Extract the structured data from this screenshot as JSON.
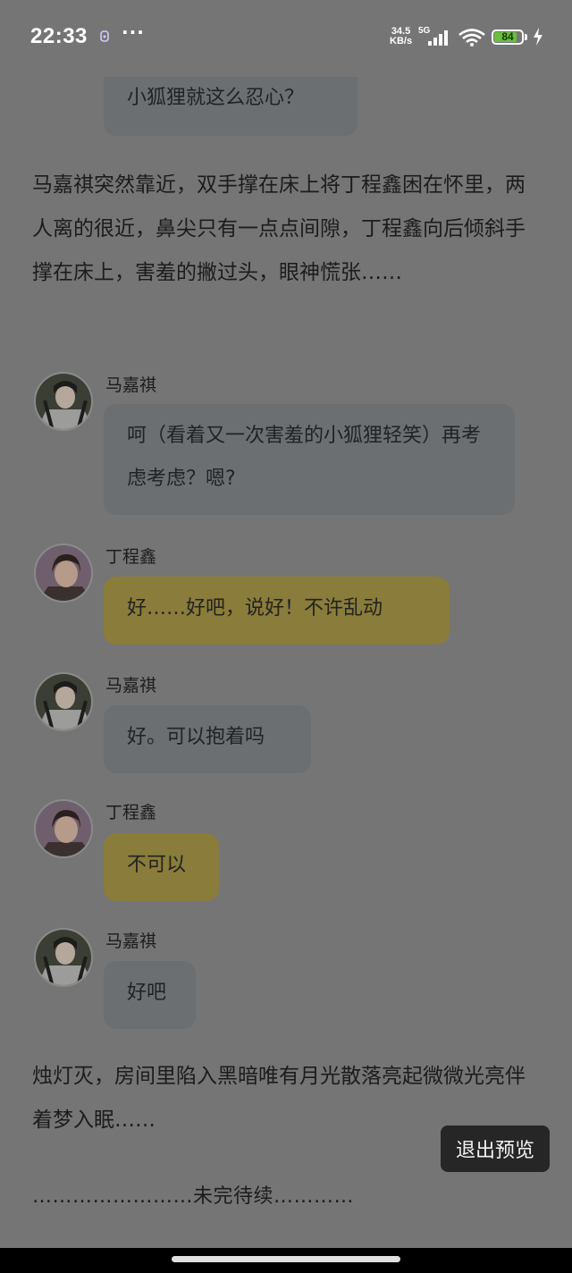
{
  "status_bar": {
    "time": "22:33",
    "more": "···",
    "net_speed_value": "34.5",
    "net_speed_unit": "KB/s",
    "network": "5G",
    "battery": "84",
    "battery_level": 0.84
  },
  "partial_bubble": {
    "text": "小狐狸就这么忍心？"
  },
  "narration_1": "马嘉祺突然靠近，双手撑在床上将丁程鑫困在怀里，两人离的很近，鼻尖只有一点点间隙，丁程鑫向后倾斜手撑在床上，害羞的撇过头，眼神慌张……",
  "messages": [
    {
      "speaker": "马嘉祺",
      "text": "呵（看着又一次害羞的小狐狸轻笑）再考虑考虑？嗯?"
    },
    {
      "speaker": "丁程鑫",
      "text": "好……好吧，说好！不许乱动"
    },
    {
      "speaker": "马嘉祺",
      "text": "好。可以抱着吗"
    },
    {
      "speaker": "丁程鑫",
      "text": "不可以"
    },
    {
      "speaker": "马嘉祺",
      "text": "好吧"
    }
  ],
  "narration_2": "烛灯灭，房间里陷入黑暗唯有月光散落亮起微微光亮伴着梦入眠……",
  "ending": "……………………未完待续…………",
  "exit_button": "退出预览",
  "colors": {
    "overlay_bg": "#757575",
    "ma_bubble": "#6b6f72",
    "ding_bubble": "#8a7c3a",
    "battery_green": "#6abf3d"
  },
  "icons": [
    "notification-icon",
    "signal-icon",
    "wifi-icon",
    "battery-icon",
    "charging-icon",
    "avatar-ma",
    "avatar-ding"
  ]
}
